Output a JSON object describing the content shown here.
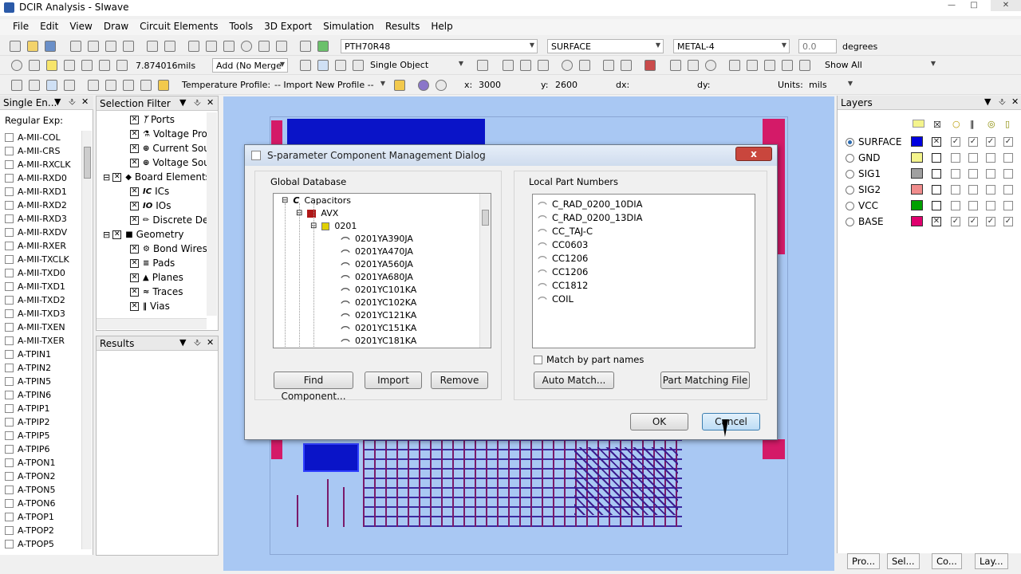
{
  "window": {
    "title": "DCIR Analysis - SIwave"
  },
  "menu": [
    "File",
    "Edit",
    "View",
    "Draw",
    "Circuit Elements",
    "Tools",
    "3D Export",
    "Simulation",
    "Results",
    "Help"
  ],
  "toolbar1": {
    "component_combo": "PTH70R48",
    "layer_combo": "SURFACE",
    "metal_combo": "METAL-4",
    "angle_value": "0.0",
    "angle_unit": "degrees"
  },
  "toolbar2": {
    "mils_value": "7.874016mils",
    "add_mode": "Add (No Merge",
    "select_mode": "Single Object",
    "show_mode": "Show All"
  },
  "toolbar3": {
    "temp_label": "Temperature Profile:",
    "temp_profile": "-- Import New Profile --",
    "x_label": "x:",
    "x_value": "3000",
    "y_label": "y:",
    "y_value": "2600",
    "dx_label": "dx:",
    "dy_label": "dy:",
    "units_label": "Units:",
    "units_value": "mils"
  },
  "single_entry_panel": {
    "title": "Single En...",
    "regular_exp_label": "Regular Exp:",
    "items": [
      "A-MII-COL",
      "A-MII-CRS",
      "A-MII-RXCLK",
      "A-MII-RXD0",
      "A-MII-RXD1",
      "A-MII-RXD2",
      "A-MII-RXD3",
      "A-MII-RXDV",
      "A-MII-RXER",
      "A-MII-TXCLK",
      "A-MII-TXD0",
      "A-MII-TXD1",
      "A-MII-TXD2",
      "A-MII-TXD3",
      "A-MII-TXEN",
      "A-MII-TXER",
      "A-TPIN1",
      "A-TPIN2",
      "A-TPIN5",
      "A-TPIN6",
      "A-TPIP1",
      "A-TPIP2",
      "A-TPIP5",
      "A-TPIP6",
      "A-TPON1",
      "A-TPON2",
      "A-TPON5",
      "A-TPON6",
      "A-TPOP1",
      "A-TPOP2",
      "A-TPOP5"
    ]
  },
  "selection_filter": {
    "title": "Selection Filter",
    "items": [
      {
        "label": "Ports",
        "indent": 2
      },
      {
        "label": "Voltage Pro",
        "indent": 2
      },
      {
        "label": "Current Sou",
        "indent": 2
      },
      {
        "label": "Voltage Sou",
        "indent": 2
      },
      {
        "label": "Board Elements",
        "indent": 1
      },
      {
        "label": "ICs",
        "indent": 2
      },
      {
        "label": "IOs",
        "indent": 2
      },
      {
        "label": "Discrete De",
        "indent": 2
      },
      {
        "label": "Geometry",
        "indent": 1
      },
      {
        "label": "Bond Wires",
        "indent": 2
      },
      {
        "label": "Pads",
        "indent": 2
      },
      {
        "label": "Planes",
        "indent": 2
      },
      {
        "label": "Traces",
        "indent": 2
      },
      {
        "label": "Vias",
        "indent": 2
      }
    ]
  },
  "results_panel": {
    "title": "Results"
  },
  "layers_panel": {
    "title": "Layers",
    "layers": [
      {
        "name": "SURFACE",
        "color": "#0000e0",
        "selected": true,
        "visible": true
      },
      {
        "name": "GND",
        "color": "#f4f48c",
        "selected": false,
        "visible": false
      },
      {
        "name": "SIG1",
        "color": "#a0a0a0",
        "selected": false,
        "visible": false
      },
      {
        "name": "SIG2",
        "color": "#f08c8c",
        "selected": false,
        "visible": false
      },
      {
        "name": "VCC",
        "color": "#00a000",
        "selected": false,
        "visible": false
      },
      {
        "name": "BASE",
        "color": "#e0006e",
        "selected": false,
        "visible": true
      }
    ]
  },
  "bottom_tabs": [
    "Pro...",
    "Sel...",
    "Co...",
    "Lay..."
  ],
  "dialog": {
    "title": "S-parameter Component Management Dialog",
    "close_label": "x",
    "global_db_label": "Global Database",
    "local_parts_label": "Local Part Numbers",
    "tree": {
      "root": "Capacitors",
      "vendor": "AVX",
      "package": "0201",
      "parts": [
        "0201YA390JA",
        "0201YA470JA",
        "0201YA560JA",
        "0201YA680JA",
        "0201YC101KA",
        "0201YC102KA",
        "0201YC121KA",
        "0201YC151KA",
        "0201YC181KA"
      ]
    },
    "local_parts": [
      "C_RAD_0200_10DIA",
      "C_RAD_0200_13DIA",
      "CC_TAJ-C",
      "CC0603",
      "CC1206",
      "CC1206",
      "CC1812",
      "COIL"
    ],
    "match_by_names_label": "Match by part names",
    "buttons": {
      "find": "Find Component...",
      "import": "Import",
      "remove": "Remove",
      "auto_match": "Auto Match...",
      "part_matching": "Part Matching File",
      "ok": "OK",
      "cancel": "Cancel"
    }
  }
}
